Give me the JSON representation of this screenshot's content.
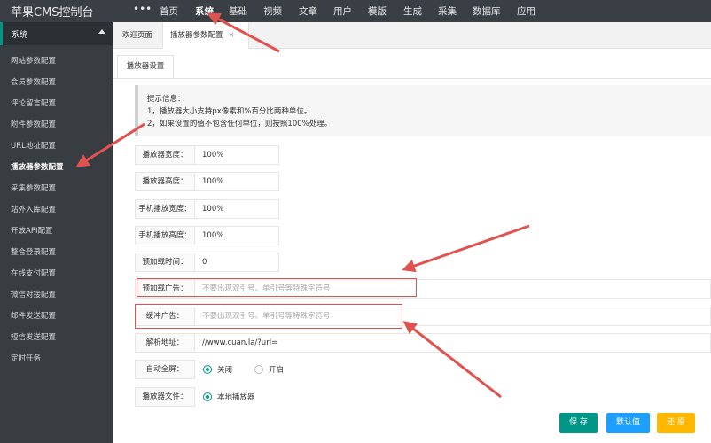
{
  "app": {
    "title": "苹果CMS控制台"
  },
  "topnav": {
    "more_glyph": "•••",
    "items": [
      {
        "label": "首页"
      },
      {
        "label": "系统",
        "active": true
      },
      {
        "label": "基础"
      },
      {
        "label": "视频"
      },
      {
        "label": "文章"
      },
      {
        "label": "用户"
      },
      {
        "label": "模版"
      },
      {
        "label": "生成"
      },
      {
        "label": "采集"
      },
      {
        "label": "数据库"
      },
      {
        "label": "应用"
      }
    ]
  },
  "sidebar": {
    "section_title": "系统",
    "items": [
      {
        "label": "网站参数配置"
      },
      {
        "label": "会员参数配置"
      },
      {
        "label": "评论留言配置"
      },
      {
        "label": "附件参数配置"
      },
      {
        "label": "URL地址配置"
      },
      {
        "label": "播放器参数配置",
        "active": true
      },
      {
        "label": "采集参数配置"
      },
      {
        "label": "站外入库配置"
      },
      {
        "label": "开放API配置"
      },
      {
        "label": "整合登录配置"
      },
      {
        "label": "在线支付配置"
      },
      {
        "label": "微信对接配置"
      },
      {
        "label": "邮件发送配置"
      },
      {
        "label": "短信发送配置"
      },
      {
        "label": "定时任务"
      }
    ]
  },
  "tabs": {
    "items": [
      {
        "label": "欢迎页面"
      },
      {
        "label": "播放器参数配置",
        "close": "×",
        "active": true
      }
    ]
  },
  "subtab": {
    "label": "播放器设置"
  },
  "tip": {
    "lines": [
      "提示信息：",
      "1，播放器大小支持px像素和%百分比两种单位。",
      "2，如果设置的值不包含任何单位，则按照100%处理。"
    ]
  },
  "form": {
    "width": {
      "label": "播放器宽度：",
      "value": "100%"
    },
    "height": {
      "label": "播放器高度：",
      "value": "100%"
    },
    "mobile_width": {
      "label": "手机播放宽度：",
      "value": "100%"
    },
    "mobile_height": {
      "label": "手机播放高度：",
      "value": "100%"
    },
    "preload_time": {
      "label": "预加载时间：",
      "value": "0"
    },
    "preload_ad": {
      "label": "预加载广告：",
      "placeholder": "不要出现双引号、单引号等特殊字符号"
    },
    "buffer_ad": {
      "label": "缓冲广告：",
      "placeholder": "不要出现双引号、单引号等特殊字符号"
    },
    "parse_url": {
      "label": "解析地址：",
      "value": "//www.cuan.la/?url="
    },
    "autofull": {
      "label": "自动全屏：",
      "options": [
        "关闭",
        "开启"
      ],
      "selected": "关闭"
    },
    "player_file": {
      "label": "播放器文件：",
      "options": [
        "本地播放器"
      ],
      "selected": "本地播放器"
    }
  },
  "buttons": {
    "save": "保 存",
    "default": "默认值",
    "reset": "还 原"
  },
  "colors": {
    "accent": "#009688",
    "highlight": "#e0524f",
    "arrow": "#e0524f",
    "topbar": "#3a3f45",
    "sidebar": "#373d41"
  }
}
